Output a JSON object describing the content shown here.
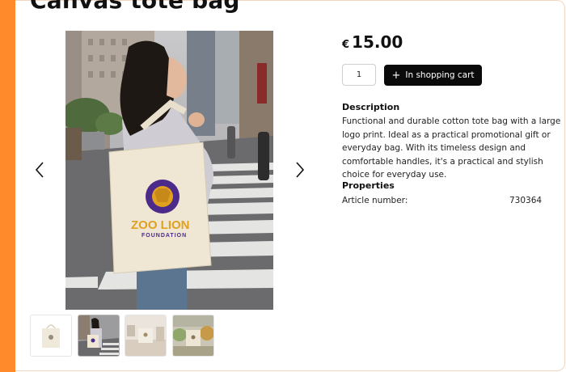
{
  "product": {
    "title": "Canvas tote bag",
    "price": {
      "currency": "€",
      "amount": "15.00"
    },
    "quantity": "1",
    "cart_button_label": "In shopping cart",
    "description": {
      "heading": "Description",
      "text": "Functional and durable cotton tote bag with a large logo print. Ideal as a practical promotional gift or everyday bag. With its timeless design and comfortable handles, it's a practical and stylish choice for everyday use."
    },
    "properties": {
      "heading": "Properties",
      "rows": [
        {
          "key": "Article number:",
          "value": "730364"
        }
      ]
    }
  },
  "gallery": {
    "selected_index": 1,
    "thumbnails": [
      "bag-only",
      "woman-with-bag",
      "bag-on-table",
      "bag-at-market"
    ]
  },
  "bag_print": {
    "line1": "ZOO LION",
    "line2": "FOUNDATION"
  },
  "colors": {
    "accent": "#ff8a2b",
    "button": "#0a0a0a",
    "logo_purple": "#4b2a8a",
    "logo_gold": "#e0a020"
  }
}
